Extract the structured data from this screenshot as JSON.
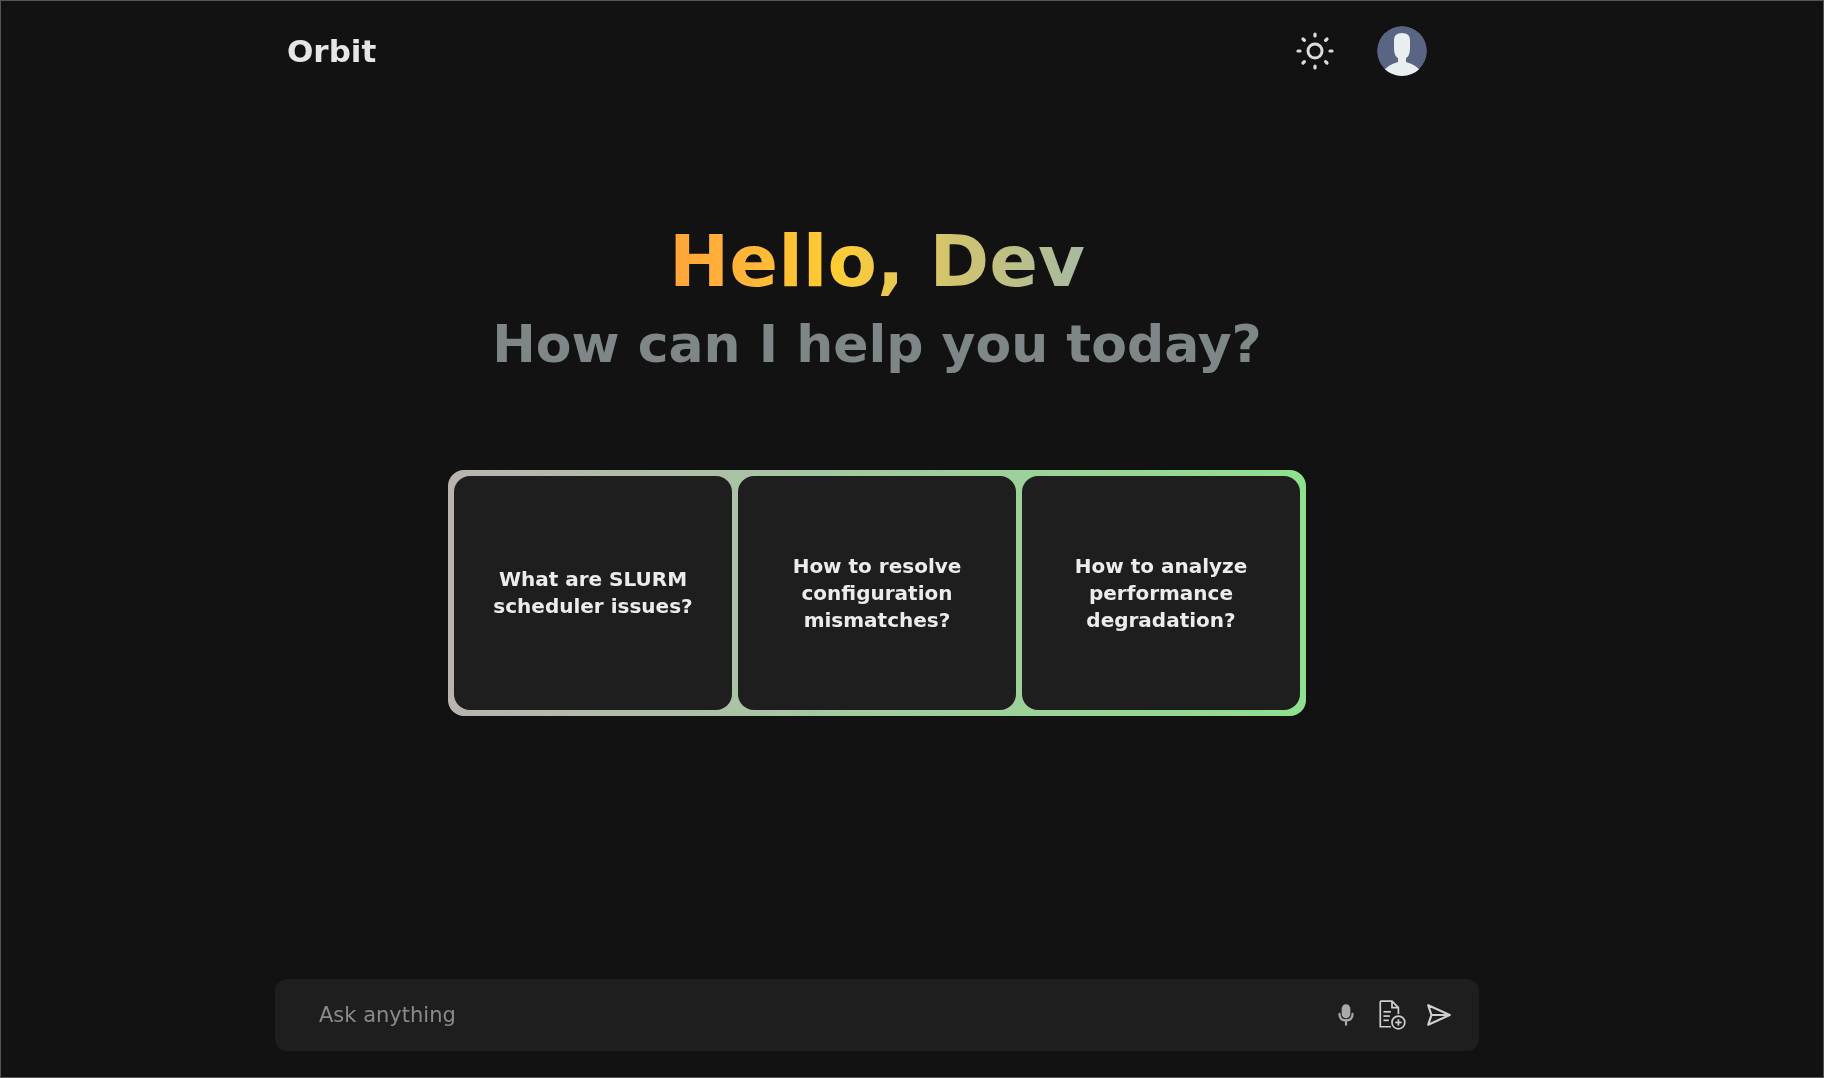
{
  "header": {
    "logo": "Orbit"
  },
  "greeting": {
    "title": "Hello, Dev",
    "subtitle": "How can I help you today?"
  },
  "suggestions": [
    {
      "text": "What are SLURM scheduler issues?"
    },
    {
      "text": "How to resolve configuration mismatches?"
    },
    {
      "text": "How to analyze performance degradation?"
    }
  ],
  "prompt": {
    "placeholder": "Ask anything"
  }
}
